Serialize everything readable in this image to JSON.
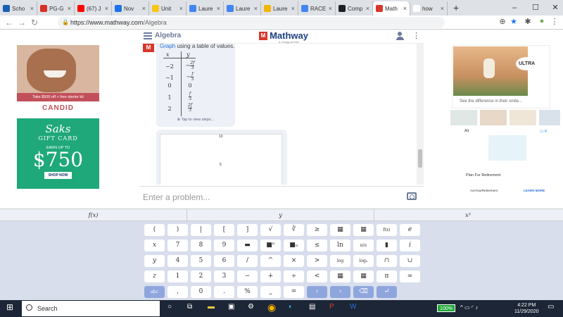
{
  "browser": {
    "tabs": [
      {
        "label": "Scho",
        "color": "#1a5fb4"
      },
      {
        "label": "PG-G",
        "color": "#d93025"
      },
      {
        "label": "(67) J",
        "color": "#ff0000"
      },
      {
        "label": "Nov",
        "color": "#1a73e8"
      },
      {
        "label": "Unit",
        "color": "#f9c513"
      },
      {
        "label": "Laure",
        "color": "#4285f4"
      },
      {
        "label": "Laure",
        "color": "#4285f4"
      },
      {
        "label": "Laure",
        "color": "#f4b400"
      },
      {
        "label": "RACE",
        "color": "#4285f4"
      },
      {
        "label": "Comp",
        "color": "#202124"
      },
      {
        "label": "Math",
        "color": "#d9362b"
      },
      {
        "label": "how",
        "color": "#ffffff"
      }
    ],
    "url_host": "https://www.mathway.com",
    "url_path": "/Algebra"
  },
  "app": {
    "subject": "Algebra",
    "logo_badge": "M",
    "logo_text": "Mathway",
    "logo_sub": "a Chegg service",
    "instruction_prefix": "Graph",
    "instruction_rest": "using a table of values.",
    "table_x_header": "x",
    "table_y_header": "y",
    "table_rows": [
      {
        "x": "−2",
        "sign": "−",
        "num": "2f",
        "den": "3"
      },
      {
        "x": "−1",
        "sign": "−",
        "num": "f",
        "den": "3"
      },
      {
        "x": "0",
        "sign": "",
        "num": "",
        "den": "",
        "plain": "0"
      },
      {
        "x": "1",
        "sign": "",
        "num": "f",
        "den": "3"
      },
      {
        "x": "2",
        "sign": "",
        "num": "2f",
        "den": "3"
      }
    ],
    "tap_text": "Tap to view steps...",
    "graph_tick_top": "10",
    "graph_tick_mid": "5",
    "input_placeholder": "Enter a problem..."
  },
  "ads": {
    "candid_strip": "Take $500 off + free starter kit",
    "candid_brand": "CANDID",
    "saks_title": "Saks",
    "saks_gift": "GIFT CARD",
    "saks_earn": "EARN UP TO",
    "saks_amount": "$750",
    "saks_shop": "SHOP NOW",
    "ultra_logo": "ULTRA",
    "ultra_caption": "See the difference in their smile...",
    "ad_label": "Ad",
    "plan": "Plan For Retirement",
    "ace": "AceYourRetirement",
    "learn": "LEARN MORE"
  },
  "keyboard": {
    "tabs": [
      "f(x)",
      "y",
      "x³"
    ],
    "rows": [
      [
        "(",
        ")",
        "|",
        "[",
        "]",
        "√",
        "∛",
        "≥",
        "▦",
        "▦",
        "f(x)",
        "e"
      ],
      [
        "x",
        "7",
        "8",
        "9",
        "▬",
        "■ⁿ",
        "■ₙ",
        "≤",
        "ln",
        "π/e",
        "▮",
        "i"
      ],
      [
        "y",
        "4",
        "5",
        "6",
        "/",
        "^",
        "×",
        ">",
        "log",
        "logₙ",
        "∩",
        "∪"
      ],
      [
        "z",
        "1",
        "2",
        "3",
        "−",
        "+",
        "÷",
        "<",
        "▦",
        "▦",
        "π",
        "∞"
      ],
      [
        "abc",
        ",",
        "0",
        ".",
        "%",
        "⎵",
        "=",
        "‹",
        "›",
        "⌫",
        "↵",
        ""
      ]
    ]
  },
  "taskbar": {
    "search": "Search",
    "battery": "100%",
    "time": "4:22 PM",
    "date": "11/29/2020"
  }
}
